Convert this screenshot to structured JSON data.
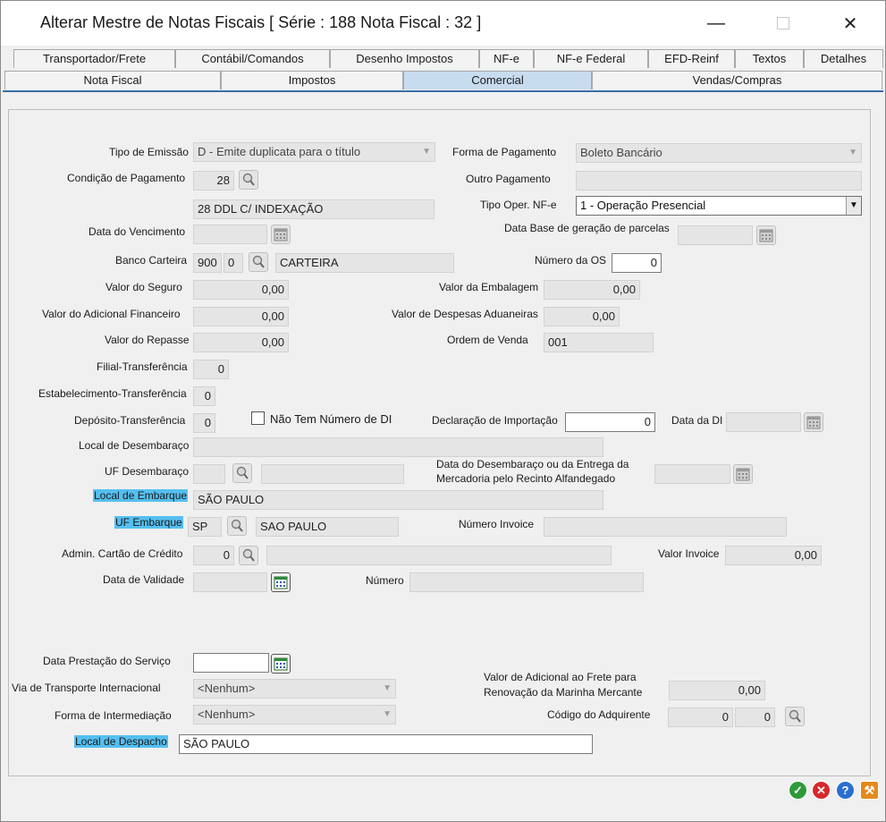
{
  "window": {
    "title": "Alterar Mestre de Notas Fiscais [ Série : 188 Nota Fiscal : 32 ]"
  },
  "tabs_top": [
    "Transportador/Frete",
    "Contábil/Comandos",
    "Desenho Impostos",
    "NF-e",
    "NF-e Federal",
    "EFD-Reinf",
    "Textos",
    "Detalhes"
  ],
  "tabs_bottom": [
    "Nota Fiscal",
    "Impostos",
    "Comercial",
    "Vendas/Compras"
  ],
  "active_tab": "Comercial",
  "form": {
    "tipo_emissao": {
      "label": "Tipo de Emissão",
      "value": "D - Emite duplicata para o título"
    },
    "forma_pagamento": {
      "label": "Forma de Pagamento",
      "value": "Boleto Bancário"
    },
    "condicao_pagamento": {
      "label": "Condição de Pagamento",
      "code": "28",
      "desc": "28 DDL C/ INDEXAÇÃO"
    },
    "outro_pagamento": {
      "label": "Outro Pagamento",
      "value": ""
    },
    "tipo_oper_nfe": {
      "label": "Tipo Oper. NF-e",
      "value": "1 - Operação Presencial"
    },
    "data_vencimento": {
      "label": "Data do Vencimento",
      "value": ""
    },
    "data_base_parcelas": {
      "label": "Data Base de geração de parcelas",
      "value": ""
    },
    "banco_carteira": {
      "label": "Banco Carteira",
      "banco": "900",
      "carteira": "0",
      "desc": "CARTEIRA"
    },
    "numero_os": {
      "label": "Número da OS",
      "value": "0"
    },
    "valor_seguro": {
      "label": "Valor do Seguro",
      "value": "0,00"
    },
    "valor_embalagem": {
      "label": "Valor da Embalagem",
      "value": "0,00"
    },
    "valor_adicional_financeiro": {
      "label": "Valor do Adicional Financeiro",
      "value": "0,00"
    },
    "valor_despesas_aduaneiras": {
      "label": "Valor de Despesas Aduaneiras",
      "value": "0,00"
    },
    "valor_repasse": {
      "label": "Valor do Repasse",
      "value": "0,00"
    },
    "ordem_venda": {
      "label": "Ordem de Venda",
      "value": "001"
    },
    "filial_transferencia": {
      "label": "Filial-Transferência",
      "value": "0"
    },
    "estabelecimento_transferencia": {
      "label": "Estabelecimento-Transferência",
      "value": "0"
    },
    "deposito_transferencia": {
      "label": "Depósito-Transferência",
      "value": "0"
    },
    "nao_tem_numero_di": {
      "label": "Não Tem Número de DI"
    },
    "declaracao_importacao": {
      "label": "Declaração de Importação",
      "value": "0"
    },
    "data_di": {
      "label": "Data da DI",
      "value": ""
    },
    "local_desembaraco": {
      "label": "Local de Desembaraço",
      "value": ""
    },
    "uf_desembaraco": {
      "label": "UF Desembaraço",
      "value": "",
      "desc": ""
    },
    "data_desembaraco": {
      "label_line1": "Data do Desembaraço ou da Entrega da",
      "label_line2": "Mercadoria pelo Recinto Alfandegado",
      "value": ""
    },
    "local_embarque": {
      "label": "Local de Embarque",
      "value": "SÃO PAULO"
    },
    "uf_embarque": {
      "label": "UF Embarque",
      "value": "SP",
      "desc": "SAO PAULO"
    },
    "numero_invoice": {
      "label": "Número Invoice",
      "value": ""
    },
    "admin_cartao": {
      "label": "Admin. Cartão de Crédito",
      "value": "0",
      "desc": ""
    },
    "valor_invoice": {
      "label": "Valor Invoice",
      "value": "0,00"
    },
    "data_validade": {
      "label": "Data de Validade",
      "value": ""
    },
    "numero": {
      "label": "Número",
      "value": ""
    },
    "data_prestacao": {
      "label": "Data Prestação do Serviço",
      "value": ""
    },
    "via_transporte": {
      "label": "Via de Transporte Internacional",
      "value": "<Nenhum>"
    },
    "valor_adicional_frete": {
      "label_line1": "Valor de Adicional ao Frete para",
      "label_line2": "Renovação da Marinha Mercante",
      "value": "0,00"
    },
    "forma_intermediacao": {
      "label": "Forma de Intermediação",
      "value": "<Nenhum>"
    },
    "codigo_adquirente": {
      "label": "Código do Adquirente",
      "value1": "0",
      "value2": "0"
    },
    "local_despacho": {
      "label": "Local de Despacho",
      "value": "SÃO PAULO"
    }
  },
  "colors": {
    "highlight": "#55bff0",
    "active_tab": "#c8dcef",
    "tab_line": "#3a6fa8",
    "ok": "#2e9a3a",
    "cancel": "#d6282c",
    "help": "#2a6fd0",
    "tools": "#e38a1d"
  }
}
